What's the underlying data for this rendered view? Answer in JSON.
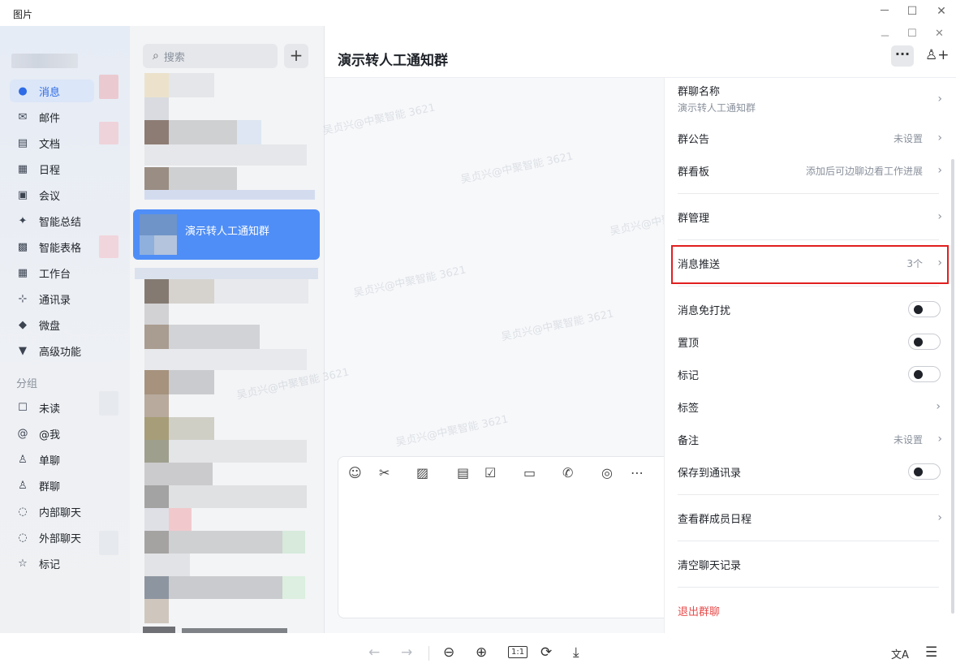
{
  "viewer": {
    "title": "图片",
    "controls": {
      "minimize": "－",
      "maximize": "☐",
      "close": "✕"
    },
    "toolbar": {
      "prev_icon": "←",
      "next_icon": "→",
      "zoom_out_icon": "⊖",
      "zoom_in_icon": "⊕",
      "actual_size": "1:1",
      "rotate_icon": "⟳",
      "download_icon": "⤓",
      "translate_icon": "文A",
      "ocr_icon": "☰"
    }
  },
  "nav": {
    "items": [
      {
        "label": "消息",
        "icon": "●",
        "active": true
      },
      {
        "label": "邮件",
        "icon": "✉"
      },
      {
        "label": "文档",
        "icon": "▤"
      },
      {
        "label": "日程",
        "icon": "▦"
      },
      {
        "label": "会议",
        "icon": "▣"
      },
      {
        "label": "智能总结",
        "icon": "✦"
      },
      {
        "label": "智能表格",
        "icon": "▩"
      },
      {
        "label": "工作台",
        "icon": "▦"
      },
      {
        "label": "通讯录",
        "icon": "⊹"
      },
      {
        "label": "微盘",
        "icon": "◆"
      },
      {
        "label": "高级功能",
        "icon": "▼"
      }
    ],
    "section_label": "分组",
    "groups": [
      {
        "label": "未读",
        "icon": "☐"
      },
      {
        "label": "@我",
        "icon": "@"
      },
      {
        "label": "单聊",
        "icon": "♙"
      },
      {
        "label": "群聊",
        "icon": "♙"
      },
      {
        "label": "内部聊天",
        "icon": "◌"
      },
      {
        "label": "外部聊天",
        "icon": "◌"
      },
      {
        "label": "标记",
        "icon": "☆"
      }
    ]
  },
  "list": {
    "search_placeholder": "搜索",
    "search_icon": "⌕",
    "add_icon": "+",
    "active_chat": "演示转人工通知群"
  },
  "conversation": {
    "title": "演示转人工通知群",
    "more_icon": "···",
    "add_member_icon": "♙+",
    "watermark": "吴贞兴@中聚智能 3621",
    "composer_tools": [
      "☺",
      "✂",
      "▨",
      "▤",
      "☑",
      "▭",
      "✆",
      "◎",
      "⋯"
    ]
  },
  "panel": {
    "group_name": {
      "label": "群聊名称",
      "value": "演示转人工通知群"
    },
    "announcement": {
      "label": "群公告",
      "value": "未设置"
    },
    "board": {
      "label": "群看板",
      "value": "添加后可边聊边看工作进展"
    },
    "manage": {
      "label": "群管理"
    },
    "push": {
      "label": "消息推送",
      "value": "3个"
    },
    "mute": {
      "label": "消息免打扰"
    },
    "pin": {
      "label": "置顶"
    },
    "mark": {
      "label": "标记"
    },
    "tags": {
      "label": "标签"
    },
    "remark": {
      "label": "备注",
      "value": "未设置"
    },
    "save_contacts": {
      "label": "保存到通讯录"
    },
    "member_schedule": {
      "label": "查看群成员日程"
    },
    "clear_history": {
      "label": "清空聊天记录"
    },
    "quit": {
      "label": "退出群聊",
      "color": "#e84b4b"
    },
    "chevron": "›"
  },
  "colors": {
    "accent": "#2e6be6",
    "active_chat": "#4f8ef7",
    "highlight_box": "#e11f1f"
  }
}
